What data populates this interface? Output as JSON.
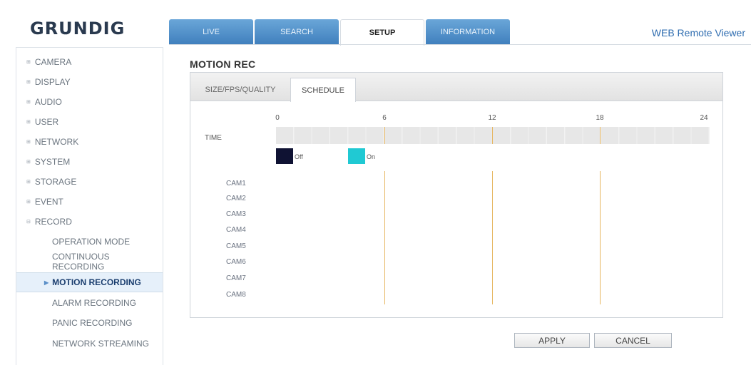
{
  "brand": {
    "logo": "GRUNDIG",
    "app_title": "WEB Remote Viewer"
  },
  "tabs": [
    {
      "label": "LIVE"
    },
    {
      "label": "SEARCH"
    },
    {
      "label": "SETUP"
    },
    {
      "label": "INFORMATION"
    }
  ],
  "sidebar": {
    "items": [
      {
        "label": "CAMERA"
      },
      {
        "label": "DISPLAY"
      },
      {
        "label": "AUDIO"
      },
      {
        "label": "USER"
      },
      {
        "label": "NETWORK"
      },
      {
        "label": "SYSTEM"
      },
      {
        "label": "STORAGE"
      },
      {
        "label": "EVENT"
      },
      {
        "label": "RECORD"
      }
    ],
    "record_sub": [
      {
        "label": "OPERATION MODE"
      },
      {
        "label": "CONTINUOUS RECORDING"
      },
      {
        "label": "MOTION RECORDING"
      },
      {
        "label": "ALARM RECORDING"
      },
      {
        "label": "PANIC RECORDING"
      },
      {
        "label": "NETWORK STREAMING"
      }
    ]
  },
  "main": {
    "title": "MOTION REC",
    "panel_tabs": [
      {
        "label": "SIZE/FPS/QUALITY"
      },
      {
        "label": "SCHEDULE"
      }
    ],
    "schedule": {
      "time_label": "TIME",
      "ticks": [
        "0",
        "6",
        "12",
        "18",
        "24"
      ],
      "legend": [
        {
          "label": "Off",
          "color": "#0f1233"
        },
        {
          "label": "On",
          "color": "#20c9d3"
        }
      ],
      "cameras": [
        "CAM1",
        "CAM2",
        "CAM3",
        "CAM4",
        "CAM5",
        "CAM6",
        "CAM7",
        "CAM8"
      ]
    },
    "buttons": {
      "apply": "APPLY",
      "cancel": "CANCEL"
    }
  },
  "colors": {
    "accent": "#3f7fbd",
    "marker": "#e6b660"
  }
}
